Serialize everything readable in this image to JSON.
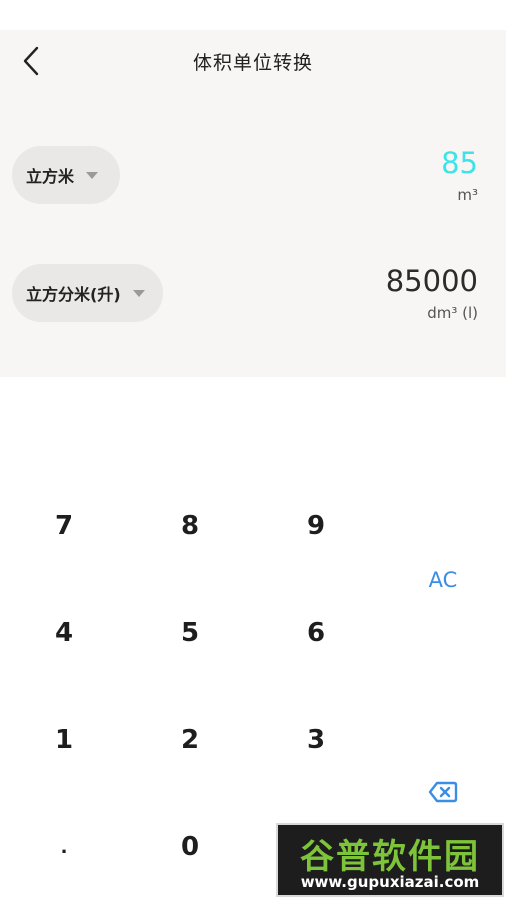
{
  "header": {
    "title": "体积单位转换",
    "back_icon": "chevron-left-icon"
  },
  "converter": {
    "from": {
      "unit_name": "立方米",
      "value": "85",
      "unit_symbol": "m³",
      "value_color": "#3ee3ea"
    },
    "to": {
      "unit_name": "立方分米(升)",
      "value": "85000",
      "unit_symbol": "dm³ (l)",
      "value_color": "#2b2b2b"
    }
  },
  "keypad": {
    "keys": [
      "7",
      "8",
      "9",
      "4",
      "5",
      "6",
      "1",
      "2",
      "3",
      ".",
      "0"
    ],
    "ac_label": "AC",
    "delete_icon": "backspace-icon",
    "accent_color": "#3a8ee6"
  },
  "watermark": {
    "text": "谷普软件园",
    "url": "www.gupuxiazai.com"
  }
}
